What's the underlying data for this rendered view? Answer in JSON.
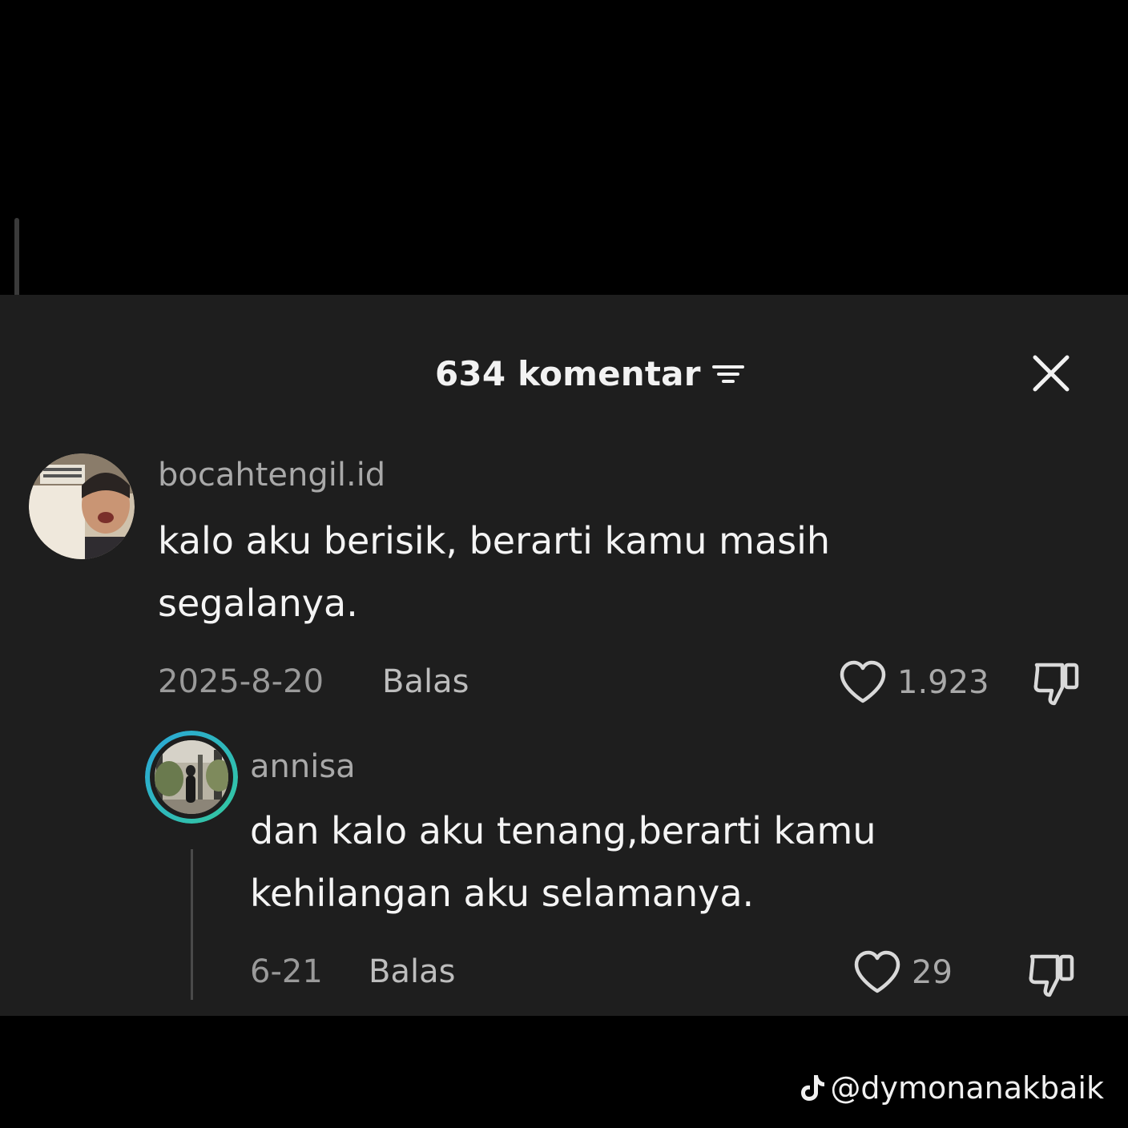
{
  "header": {
    "title": "634 komentar",
    "filter_icon": "filter-icon",
    "close_icon": "close-icon"
  },
  "comments": [
    {
      "username": "bocahtengil.id",
      "text_lines": [
        "kalo aku berisik, berarti kamu masih",
        "segalanya."
      ],
      "date": "2025-8-20",
      "reply_label": "Balas",
      "likes": "1.923"
    }
  ],
  "replies": [
    {
      "username": "annisa",
      "text_lines": [
        "dan kalo aku tenang,berarti kamu",
        "kehilangan aku selamanya."
      ],
      "date": "6-21",
      "reply_label": "Balas",
      "likes": "29"
    }
  ],
  "watermark": {
    "handle": "@dymonanakbaik",
    "icon": "tiktok-icon"
  },
  "colors": {
    "background": "#000000",
    "sheet": "#1e1e1e",
    "story_ring_start": "#2aa7d8",
    "story_ring_end": "#33c8a0"
  }
}
